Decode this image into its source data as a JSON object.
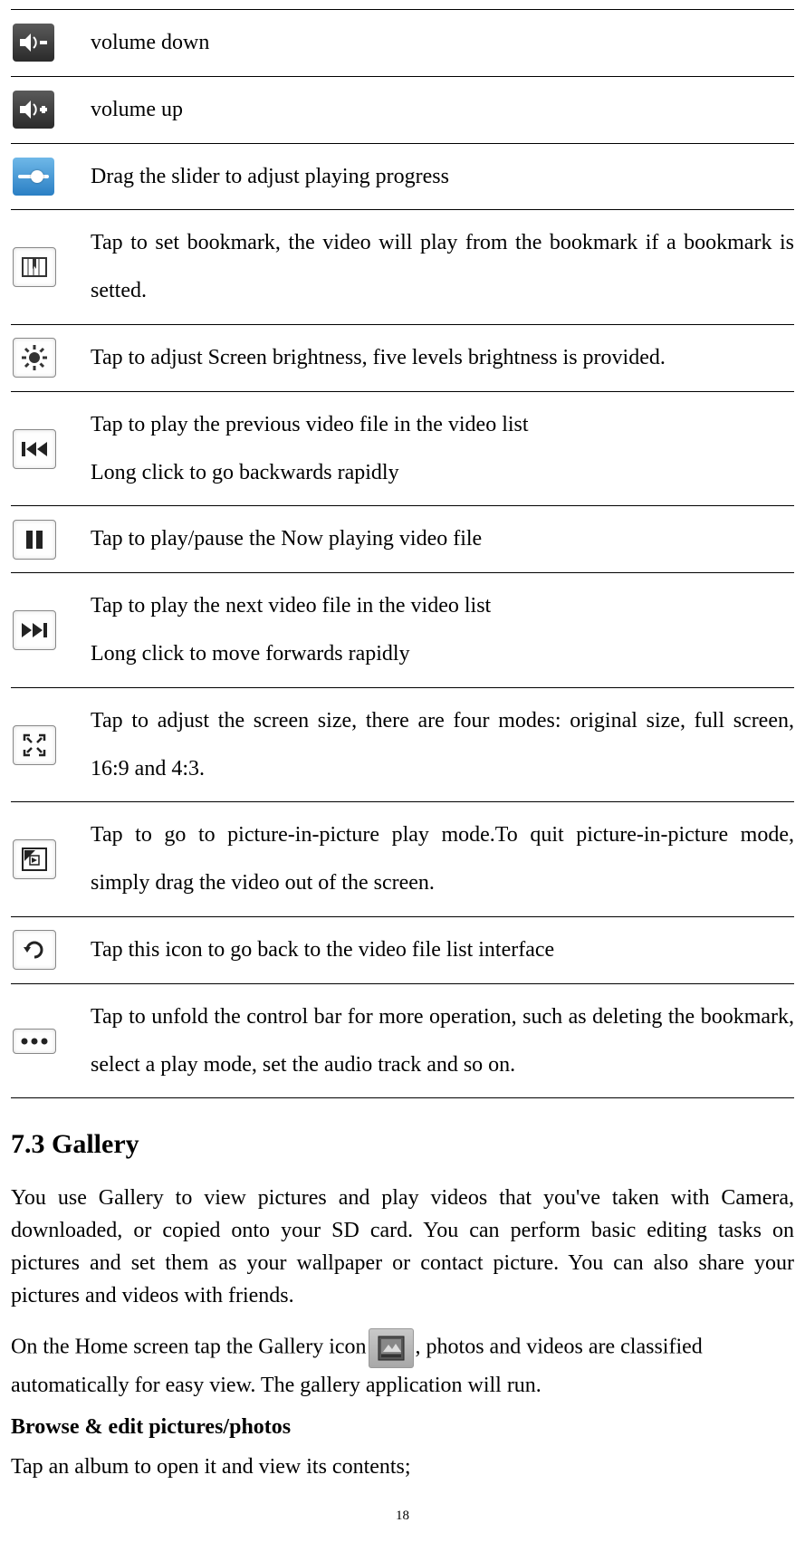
{
  "rows": [
    {
      "icon": "volume-down-icon",
      "desc": "volume down",
      "justify": false
    },
    {
      "icon": "volume-up-icon",
      "desc": "volume up",
      "justify": false
    },
    {
      "icon": "progress-slider-icon",
      "desc": "Drag the slider to adjust playing progress",
      "justify": false
    },
    {
      "icon": "bookmark-icon",
      "desc": "Tap to set bookmark, the video will play from the bookmark if a bookmark is setted.",
      "justify": true
    },
    {
      "icon": "brightness-icon",
      "desc": "Tap to adjust Screen brightness, five levels brightness is provided.",
      "justify": false
    },
    {
      "icon": "previous-icon",
      "desc": "Tap to play the previous video file in the video list\nLong click to go backwards rapidly",
      "justify": false
    },
    {
      "icon": "play-pause-icon",
      "desc": "Tap to play/pause the Now playing video file",
      "justify": false
    },
    {
      "icon": "next-icon",
      "desc": "Tap to play the next video file in the video list\nLong click to move forwards rapidly",
      "justify": false
    },
    {
      "icon": "screen-size-icon",
      "desc": "Tap to adjust the screen size, there are four modes: original size, full screen, 16:9 and 4:3.",
      "justify": true
    },
    {
      "icon": "pip-icon",
      "desc": "Tap to go to picture-in-picture play mode.To quit picture-in-picture mode, simply drag the video out of the screen.",
      "justify": true
    },
    {
      "icon": "back-icon",
      "desc": "Tap this icon to go back to the video file list interface",
      "justify": false
    },
    {
      "icon": "more-icon",
      "desc": "Tap to unfold the control bar for more operation, such as deleting the bookmark, select a play mode, set the audio track and so on.",
      "justify": true
    }
  ],
  "section_heading": "7.3 Gallery",
  "para1": "You use Gallery to view pictures and play videos that you've taken with Camera, downloaded, or copied onto your SD card. You can perform basic editing tasks on pictures and set them as your wallpaper or contact picture. You can also share your pictures and videos with friends.",
  "para2_pre": "On the Home screen tap the Gallery icon",
  "para2_post": ", photos and videos are classified automatically for easy view. The gallery application will run.",
  "bold_line": "Browse & edit pictures/photos",
  "para3": "Tap an album to open it and view its contents;",
  "page_number": "18"
}
